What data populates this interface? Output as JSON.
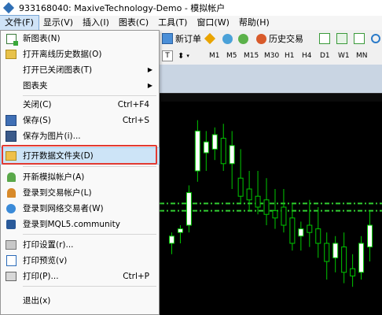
{
  "window": {
    "title": "933168040: MaxiveTechnology-Demo - 模拟帐户"
  },
  "menubar": [
    {
      "label": "文件(F)",
      "active": true
    },
    {
      "label": "显示(V)"
    },
    {
      "label": "插入(I)"
    },
    {
      "label": "图表(C)"
    },
    {
      "label": "工具(T)"
    },
    {
      "label": "窗口(W)"
    },
    {
      "label": "帮助(H)"
    }
  ],
  "toolbar": {
    "new_order": "新订单",
    "history_trading": "历史交易",
    "timeframes": [
      "M1",
      "M5",
      "M15",
      "M30",
      "H1",
      "H4",
      "D1",
      "W1",
      "MN"
    ]
  },
  "file_menu": {
    "items": [
      {
        "label": "新图表(N)",
        "icon": "new-chart-icon"
      },
      {
        "label": "打开离线历史数据(O)",
        "icon": "open-offline-folder-icon"
      },
      {
        "label": "打开已关闭图表(T)",
        "submenu": true
      },
      {
        "label": "图表夹",
        "submenu": true
      },
      {
        "label": "关闭(C)",
        "shortcut": "Ctrl+F4"
      },
      {
        "label": "保存(S)",
        "shortcut": "Ctrl+S",
        "icon": "save-icon"
      },
      {
        "label": "保存为图片(i)...",
        "icon": "save-picture-icon"
      },
      {
        "label": "打开数据文件夹(D)",
        "icon": "folder-icon",
        "highlighted": true
      },
      {
        "label": "开新模拟帐户(A)",
        "icon": "new-demo-account-icon"
      },
      {
        "label": "登录到交易帐户(L)",
        "icon": "login-trade-account-icon"
      },
      {
        "label": "登录到网络交易者(W)",
        "icon": "login-web-trader-icon"
      },
      {
        "label": "登录到MQL5.community",
        "icon": "mql5-community-icon"
      },
      {
        "label": "打印设置(r)...",
        "icon": "print-setup-icon"
      },
      {
        "label": "打印预览(v)",
        "icon": "print-preview-icon"
      },
      {
        "label": "打印(P)...",
        "shortcut": "Ctrl+P",
        "icon": "print-icon"
      },
      {
        "label": "退出(x)"
      }
    ]
  },
  "chart_data": {
    "type": "candlestick",
    "colors": {
      "background": "#000000",
      "bull_body": "#ffffff",
      "bear_body": "#000000",
      "wick": "#00c800",
      "level_line": "#32cd32"
    },
    "price_range": [
      0,
      100
    ],
    "levels": [
      52,
      48
    ],
    "candles": [
      {
        "o": 30,
        "h": 36,
        "l": 24,
        "c": 34
      },
      {
        "o": 36,
        "h": 40,
        "l": 30,
        "c": 38
      },
      {
        "o": 40,
        "h": 62,
        "l": 36,
        "c": 58
      },
      {
        "o": 70,
        "h": 98,
        "l": 64,
        "c": 92
      },
      {
        "o": 80,
        "h": 92,
        "l": 70,
        "c": 86
      },
      {
        "o": 82,
        "h": 94,
        "l": 76,
        "c": 90
      },
      {
        "o": 88,
        "h": 96,
        "l": 70,
        "c": 74
      },
      {
        "o": 74,
        "h": 92,
        "l": 60,
        "c": 84
      },
      {
        "o": 66,
        "h": 82,
        "l": 52,
        "c": 56
      },
      {
        "o": 60,
        "h": 70,
        "l": 48,
        "c": 54
      },
      {
        "o": 56,
        "h": 70,
        "l": 46,
        "c": 50
      },
      {
        "o": 54,
        "h": 66,
        "l": 40,
        "c": 46
      },
      {
        "o": 48,
        "h": 60,
        "l": 38,
        "c": 44
      },
      {
        "o": 50,
        "h": 60,
        "l": 36,
        "c": 40
      },
      {
        "o": 44,
        "h": 52,
        "l": 26,
        "c": 30
      },
      {
        "o": 34,
        "h": 42,
        "l": 26,
        "c": 38
      },
      {
        "o": 40,
        "h": 54,
        "l": 28,
        "c": 36
      },
      {
        "o": 38,
        "h": 50,
        "l": 22,
        "c": 30
      },
      {
        "o": 30,
        "h": 36,
        "l": 10,
        "c": 20
      },
      {
        "o": 22,
        "h": 34,
        "l": 14,
        "c": 30
      },
      {
        "o": 28,
        "h": 36,
        "l": 8,
        "c": 14
      },
      {
        "o": 16,
        "h": 24,
        "l": 6,
        "c": 12
      },
      {
        "o": 14,
        "h": 34,
        "l": 10,
        "c": 30
      },
      {
        "o": 28,
        "h": 48,
        "l": 20,
        "c": 40
      }
    ]
  }
}
